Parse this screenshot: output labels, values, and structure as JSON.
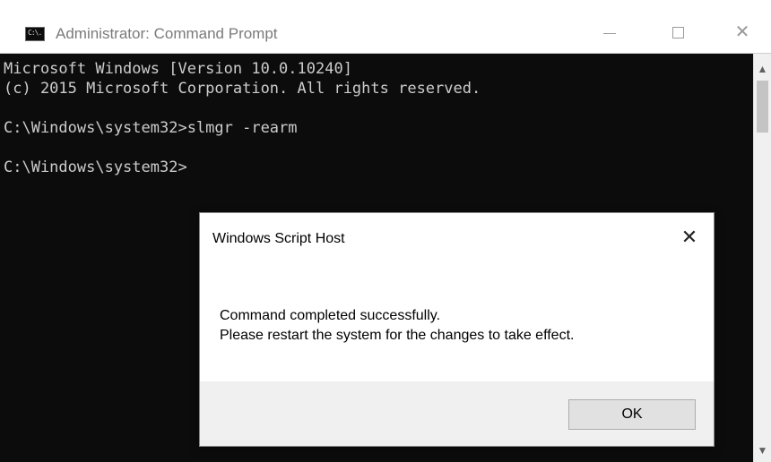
{
  "window": {
    "title": "Administrator: Command Prompt",
    "icon_label": "C:\\."
  },
  "console": {
    "lines": [
      "Microsoft Windows [Version 10.0.10240]",
      "(c) 2015 Microsoft Corporation. All rights reserved.",
      "",
      "C:\\Windows\\system32>slmgr -rearm",
      "",
      "C:\\Windows\\system32>"
    ]
  },
  "dialog": {
    "title": "Windows Script Host",
    "close_glyph": "✕",
    "message_line1": "Command completed successfully.",
    "message_line2": "Please restart the system for the changes to take effect.",
    "ok_label": "OK"
  }
}
